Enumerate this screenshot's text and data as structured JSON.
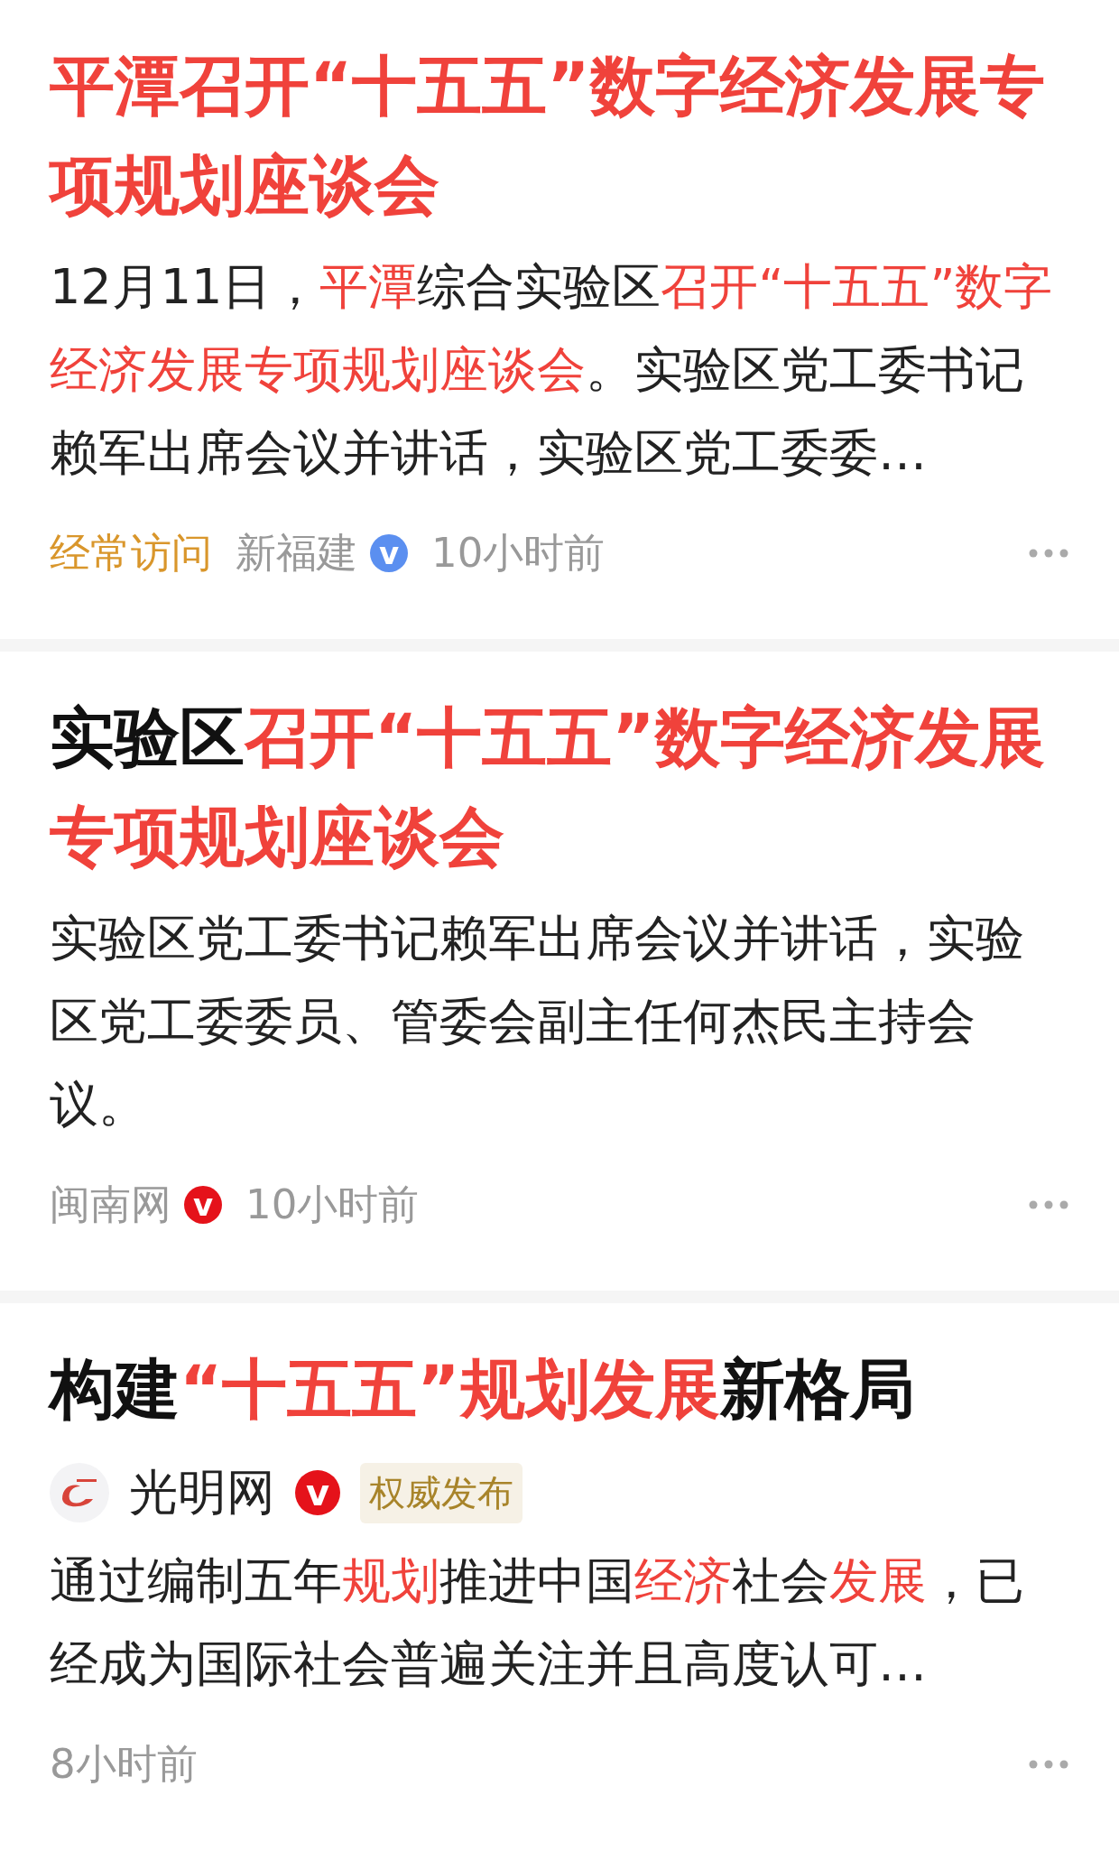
{
  "results": [
    {
      "title": [
        {
          "text": "平潭召开“十五五”数字经济发展专项规划座谈会",
          "highlighted": true
        }
      ],
      "summary": [
        {
          "text": "12月11日，",
          "highlighted": false
        },
        {
          "text": "平潭",
          "highlighted": true
        },
        {
          "text": "综合实验区",
          "highlighted": false
        },
        {
          "text": "召开“十五五”数字经济发展专项规划座谈会",
          "highlighted": true
        },
        {
          "text": "。实验区党工委书记赖军出席会议并讲话，实验区党工委委…",
          "highlighted": false
        }
      ],
      "meta": {
        "tag": "经常访问",
        "source": "新福建",
        "badge": {
          "text": "v",
          "color": "#5b8ff0"
        },
        "time": "10小时前"
      }
    },
    {
      "title": [
        {
          "text": "实验区",
          "highlighted": false
        },
        {
          "text": "召开“十五五”数字经济发展专项规划座谈会",
          "highlighted": true
        }
      ],
      "summary": [
        {
          "text": "实验区党工委书记赖军出席会议并讲话，实验区党工委委员、管委会副主任何杰民主持会议。",
          "highlighted": false
        }
      ],
      "meta": {
        "source": "闽南网",
        "badge": {
          "text": "v",
          "color": "#e5121a"
        },
        "time": "10小时前"
      }
    },
    {
      "title": [
        {
          "text": "构建",
          "highlighted": false
        },
        {
          "text": "“十五五”规划发展",
          "highlighted": true
        },
        {
          "text": "新格局",
          "highlighted": false
        }
      ],
      "author": {
        "name": "光明网",
        "badge": {
          "text": "v",
          "color": "#e5121a"
        },
        "label": "权威发布"
      },
      "summary": [
        {
          "text": "通过编制五年",
          "highlighted": false
        },
        {
          "text": "规划",
          "highlighted": true
        },
        {
          "text": "推进中国",
          "highlighted": false
        },
        {
          "text": "经济",
          "highlighted": true
        },
        {
          "text": "社会",
          "highlighted": false
        },
        {
          "text": "发展",
          "highlighted": true
        },
        {
          "text": "，已经成为国际社会普遍关注并且高度认可…",
          "highlighted": false
        }
      ],
      "meta": {
        "time": "8小时前"
      }
    }
  ]
}
